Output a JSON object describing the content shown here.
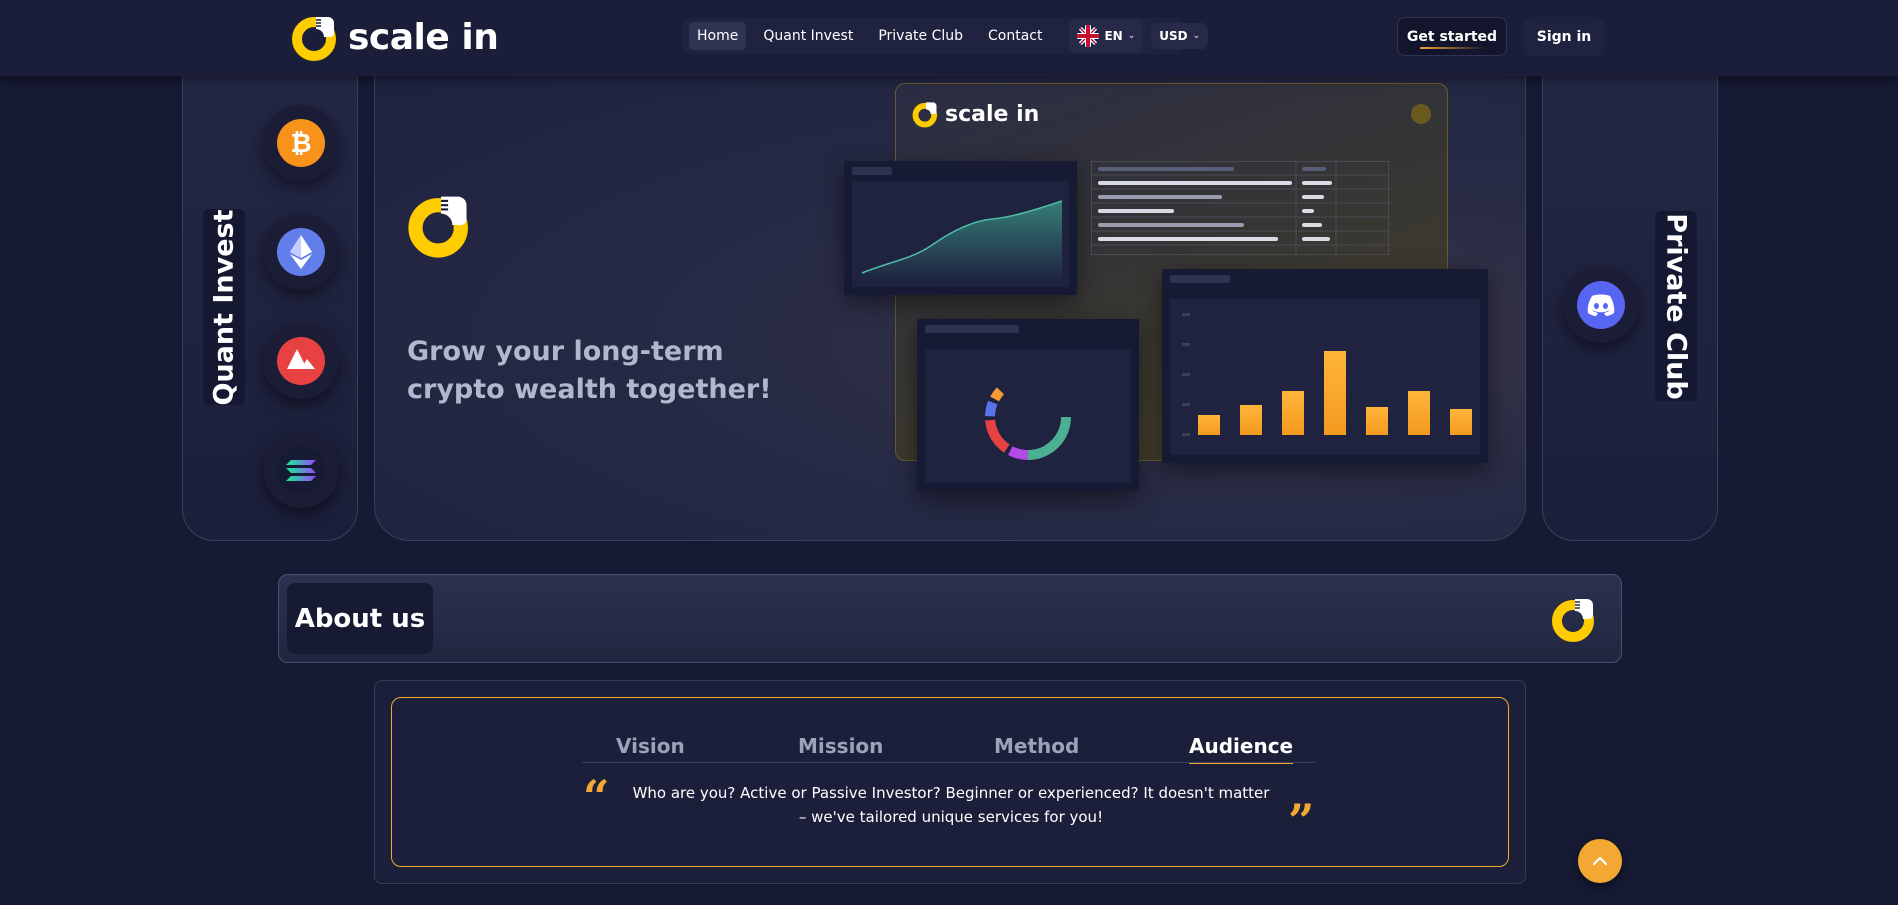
{
  "brand": {
    "name": "scale in",
    "logo_icon": "scale-in-logo-icon"
  },
  "nav": {
    "links": [
      {
        "label": "Home",
        "active": true
      },
      {
        "label": "Quant Invest",
        "active": false
      },
      {
        "label": "Private Club",
        "active": false
      },
      {
        "label": "Contact",
        "active": false
      }
    ],
    "language": {
      "code": "EN",
      "flag_icon": "uk-flag-icon"
    },
    "currency": "USD",
    "get_started_label": "Get started",
    "sign_in_label": "Sign in"
  },
  "left_panel": {
    "label": "Quant Invest",
    "coins": [
      {
        "icon": "bitcoin-icon",
        "color": "#f7931a"
      },
      {
        "icon": "ethereum-icon",
        "color": "#627eea"
      },
      {
        "icon": "avalanche-icon",
        "color": "#e84142"
      },
      {
        "icon": "solana-icon",
        "color": "#14f195"
      }
    ]
  },
  "right_panel": {
    "label": "Private Club",
    "icon": "discord-icon",
    "color": "#5865f2"
  },
  "hero": {
    "headline": "Grow your long-term crypto wealth together!",
    "mockup_brand": "scale in"
  },
  "about": {
    "title": "About us",
    "tabs": [
      {
        "label": "Vision",
        "active": false
      },
      {
        "label": "Mission",
        "active": false
      },
      {
        "label": "Method",
        "active": false
      },
      {
        "label": "Audience",
        "active": true
      }
    ],
    "quote": "Who are you? Active or Passive Investor? Beginner or experienced? It doesn't matter – we've tailored unique services for you!"
  },
  "colors": {
    "accent": "#f3a833",
    "logo_yellow": "#ffcc00",
    "background": "#161a32"
  }
}
